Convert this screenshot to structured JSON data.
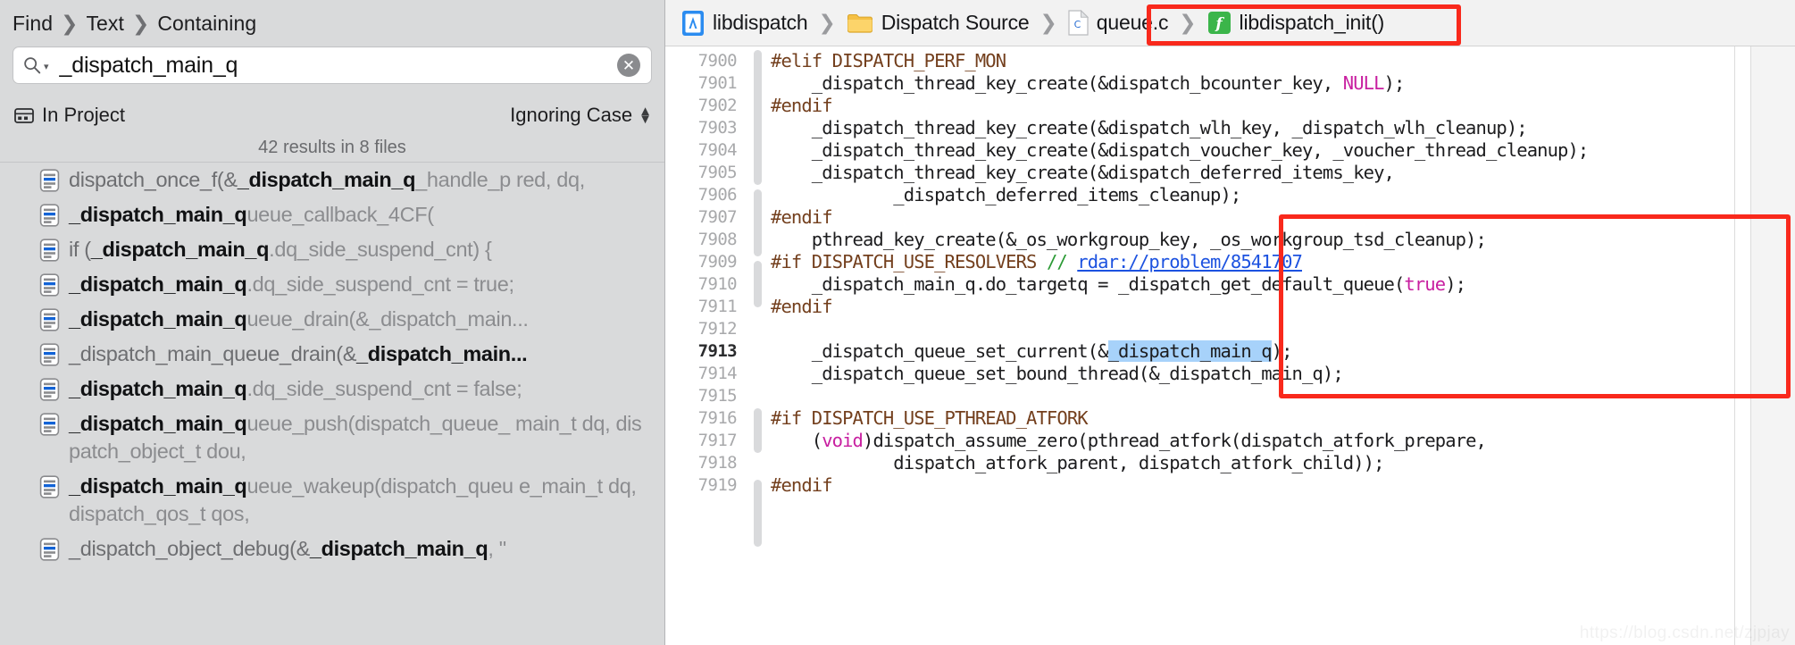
{
  "navigator": {
    "scope_breadcrumb": [
      "Find",
      "Text",
      "Containing"
    ],
    "search": {
      "value": "_dispatch_main_q",
      "placeholder": "",
      "magnifier_icon": "search-icon",
      "clear_icon": "clear-x-icon"
    },
    "filter": {
      "scope_label": "In Project",
      "case_label": "Ignoring Case",
      "scope_icon": "project-scope-icon",
      "stepper_icon": "up-down-stepper-icon"
    },
    "results_summary": "42 results in 8 files",
    "results": [
      {
        "pre": "dispatch_once_f(&",
        "match": "_dispatch_main_q",
        "post": "_handle_p",
        "cont": "red, dq,"
      },
      {
        "pre": "",
        "match": "_dispatch_main_q",
        "post": "ueue_callback_4CF(",
        "cont": ""
      },
      {
        "pre": "if (",
        "match": "_dispatch_main_q",
        "post": ".dq_side_suspend_cnt) {",
        "cont": ""
      },
      {
        "pre": "",
        "match": "_dispatch_main_q",
        "post": ".dq_side_suspend_cnt = true;",
        "cont": ""
      },
      {
        "pre": "",
        "match": "_dispatch_main_q",
        "post": "ueue_drain(&_dispatch_main...",
        "cont": ""
      },
      {
        "pre": "_dispatch_main_queue_drain(&",
        "match": "_dispatch_main...",
        "post": "",
        "cont": ""
      },
      {
        "pre": "",
        "match": "_dispatch_main_q",
        "post": ".dq_side_suspend_cnt = false;",
        "cont": ""
      },
      {
        "pre": "",
        "match": "_dispatch_main_q",
        "post": "ueue_push(dispatch_queue_",
        "cont": "main_t dq, dispatch_object_t dou,"
      },
      {
        "pre": "",
        "match": "_dispatch_main_q",
        "post": "ueue_wakeup(dispatch_queu",
        "cont": "e_main_t dq, dispatch_qos_t qos,"
      },
      {
        "pre": "_dispatch_object_debug(&",
        "match": "_dispatch_main_q",
        "post": ", \"",
        "cont": ""
      }
    ]
  },
  "editor": {
    "breadcrumb": [
      {
        "label": "libdispatch",
        "icon": "xcode-project-icon"
      },
      {
        "label": "Dispatch Source",
        "icon": "folder-icon"
      },
      {
        "label": "queue.c",
        "icon": "c-file-icon"
      },
      {
        "label": "libdispatch_init()",
        "icon": "function-symbol-icon"
      }
    ],
    "current_line": 7913,
    "lines": [
      {
        "n": 7900,
        "tokens": [
          {
            "t": "#elif DISPATCH_PERF_MON",
            "c": "pre"
          }
        ]
      },
      {
        "n": 7901,
        "tokens": [
          {
            "t": "\t_dispatch_thread_key_create(&dispatch_bcounter_key, ",
            "c": ""
          },
          {
            "t": "NULL",
            "c": "kw"
          },
          {
            "t": ");",
            "c": ""
          }
        ]
      },
      {
        "n": 7902,
        "tokens": [
          {
            "t": "#endif",
            "c": "pre"
          }
        ]
      },
      {
        "n": 7903,
        "tokens": [
          {
            "t": "\t_dispatch_thread_key_create(&dispatch_wlh_key, _dispatch_wlh_cleanup);",
            "c": ""
          }
        ]
      },
      {
        "n": 7904,
        "tokens": [
          {
            "t": "\t_dispatch_thread_key_create(&dispatch_voucher_key, _voucher_thread_cleanup);",
            "c": ""
          }
        ]
      },
      {
        "n": 7905,
        "tokens": [
          {
            "t": "\t_dispatch_thread_key_create(&dispatch_deferred_items_key,",
            "c": ""
          }
        ]
      },
      {
        "n": 7906,
        "tokens": [
          {
            "t": "\t\t\t_dispatch_deferred_items_cleanup);",
            "c": ""
          }
        ]
      },
      {
        "n": 7907,
        "tokens": [
          {
            "t": "#endif",
            "c": "pre"
          }
        ]
      },
      {
        "n": 7908,
        "tokens": [
          {
            "t": "\tpthread_key_create(&_os_workgroup_key, _os_workgroup_tsd_cleanup);",
            "c": ""
          }
        ]
      },
      {
        "n": 7909,
        "tokens": [
          {
            "t": "#if DISPATCH_USE_RESOLVERS ",
            "c": "pre"
          },
          {
            "t": "// ",
            "c": "cmt"
          },
          {
            "t": "rdar://problem/8541707",
            "c": "url"
          }
        ]
      },
      {
        "n": 7910,
        "tokens": [
          {
            "t": "\t_dispatch_main_q.do_targetq = _dispatch_get_default_queue(",
            "c": ""
          },
          {
            "t": "true",
            "c": "kw"
          },
          {
            "t": ");",
            "c": ""
          }
        ]
      },
      {
        "n": 7911,
        "tokens": [
          {
            "t": "#endif",
            "c": "pre"
          }
        ]
      },
      {
        "n": 7912,
        "tokens": [
          {
            "t": "",
            "c": ""
          }
        ]
      },
      {
        "n": 7913,
        "tokens": [
          {
            "t": "\t_dispatch_queue_set_current(&",
            "c": ""
          },
          {
            "t": "_dispatch_main_q",
            "c": "hl"
          },
          {
            "t": ");",
            "c": ""
          }
        ]
      },
      {
        "n": 7914,
        "tokens": [
          {
            "t": "\t_dispatch_queue_set_bound_thread(&_dispatch_main_q);",
            "c": ""
          }
        ]
      },
      {
        "n": 7915,
        "tokens": [
          {
            "t": "",
            "c": ""
          }
        ]
      },
      {
        "n": 7916,
        "tokens": [
          {
            "t": "#if DISPATCH_USE_PTHREAD_ATFORK",
            "c": "pre"
          }
        ]
      },
      {
        "n": 7917,
        "tokens": [
          {
            "t": "\t(",
            "c": ""
          },
          {
            "t": "void",
            "c": "kw"
          },
          {
            "t": ")dispatch_assume_zero(pthread_atfork(dispatch_atfork_prepare,",
            "c": ""
          }
        ]
      },
      {
        "n": 7918,
        "tokens": [
          {
            "t": "\t\t\tdispatch_atfork_parent, dispatch_atfork_child));",
            "c": ""
          }
        ]
      },
      {
        "n": 7919,
        "tokens": [
          {
            "t": "#endif",
            "c": "pre"
          }
        ]
      }
    ]
  },
  "annotations": {
    "breadcrumb_box_color": "#f9291c",
    "code_box_color": "#f9291c"
  },
  "watermark": "https://blog.csdn.net/zjpjay"
}
